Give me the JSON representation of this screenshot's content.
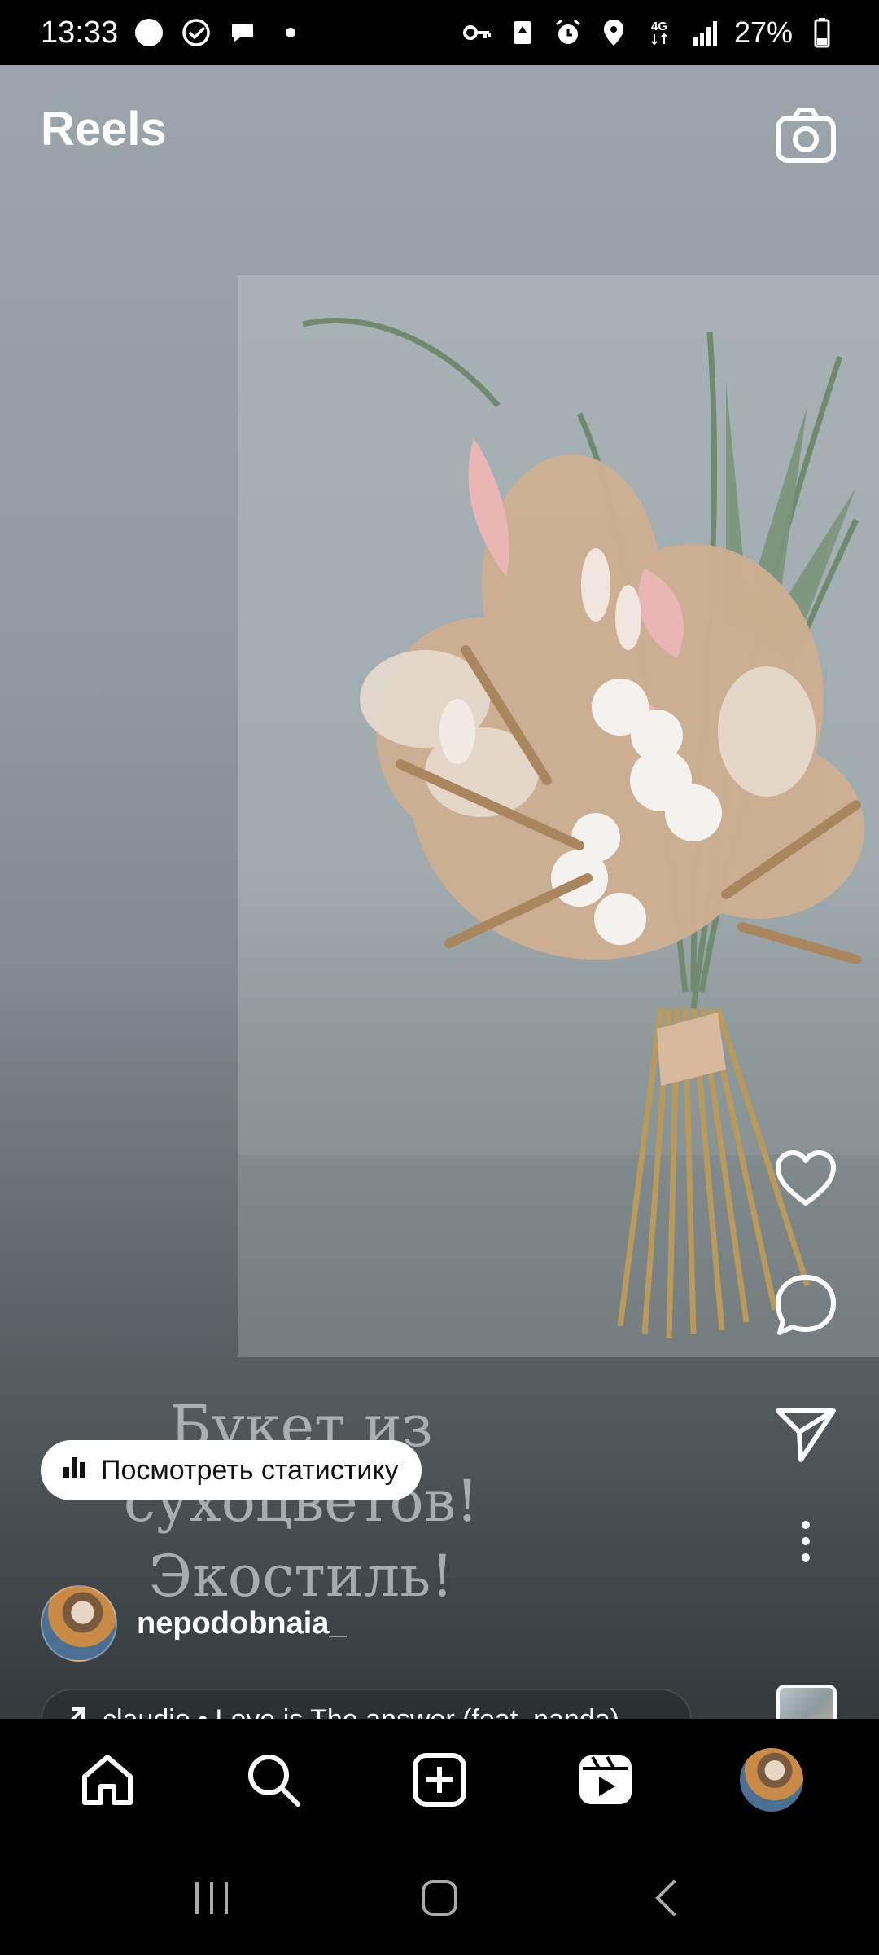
{
  "status_bar": {
    "time": "13:33",
    "battery": "27%",
    "network": "4G",
    "icons_left": [
      "notification-dot-icon",
      "check-circle-icon",
      "chat-bubble-icon",
      "dot-icon"
    ],
    "icons_right": [
      "key-icon",
      "recycle-icon",
      "alarm-icon",
      "location-icon",
      "network-4g-icon",
      "signal-icon",
      "battery-icon"
    ]
  },
  "header": {
    "title": "Reels",
    "camera_icon": "camera-icon"
  },
  "overlay": {
    "line1": "Букет из сухоцветов!",
    "line2": "Экостиль!"
  },
  "stats_button": {
    "label": "Посмотреть статистику",
    "icon": "bar-chart-icon"
  },
  "author": {
    "username": "nepodobnaia_"
  },
  "audio": {
    "label": "claudio • Love is The answer (feat. nanda)",
    "icon": "arrow-up-right-icon"
  },
  "side_actions": [
    "heart-icon",
    "comment-icon",
    "send-icon",
    "more-icon"
  ],
  "bottom_nav": [
    "home-icon",
    "search-icon",
    "create-icon",
    "reels-icon",
    "profile-avatar"
  ],
  "system_nav": [
    "recents-icon",
    "home-button-icon",
    "back-icon"
  ],
  "colors": {
    "background": "#000000",
    "pill_bg": "#ffffff",
    "text": "#ffffff"
  }
}
